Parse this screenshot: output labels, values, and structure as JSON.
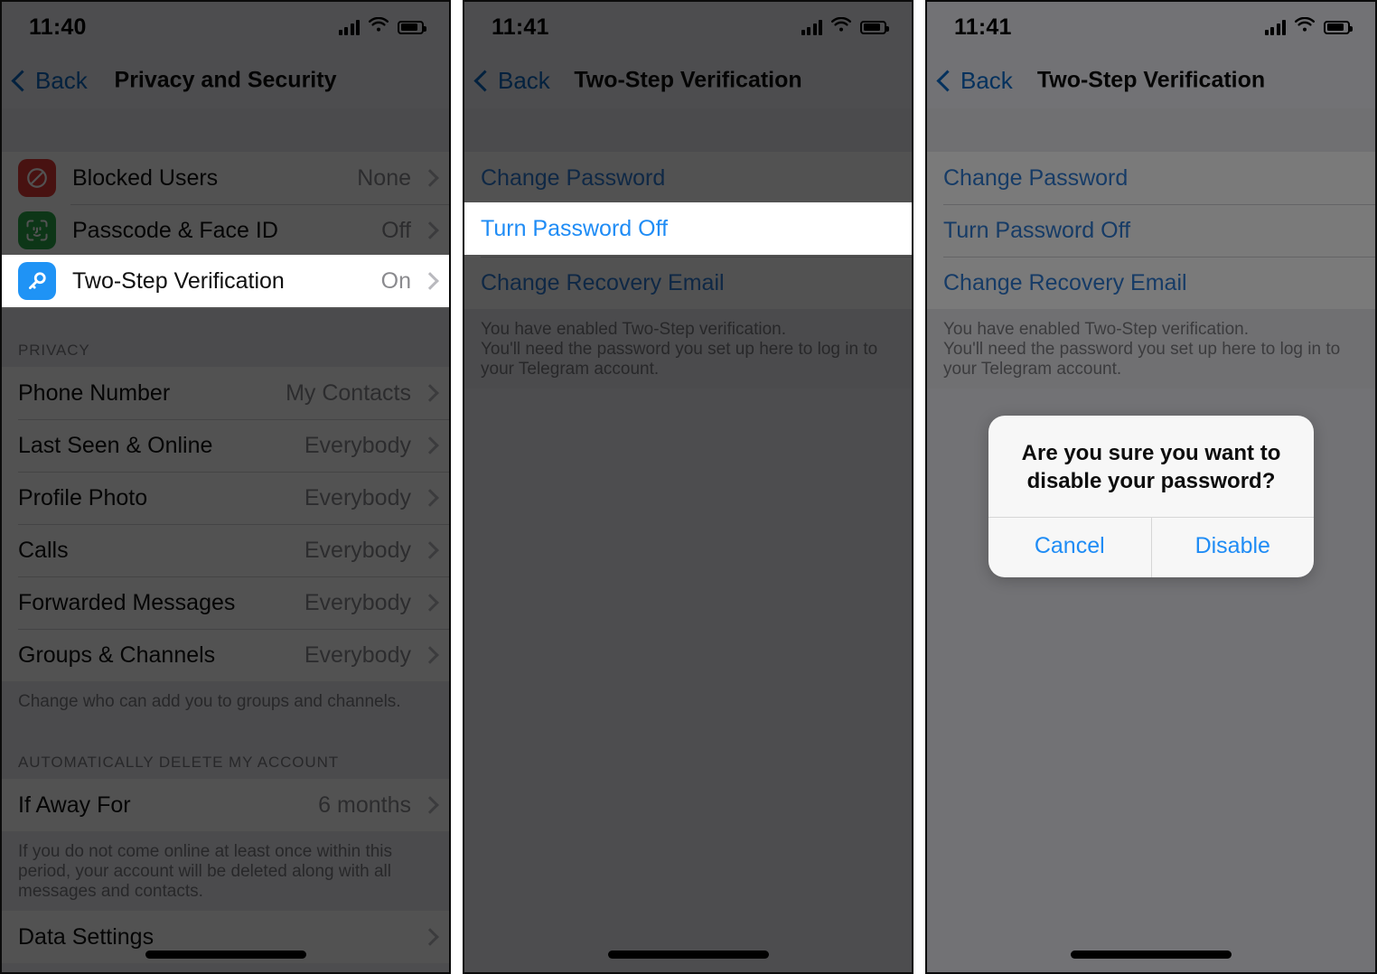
{
  "panels": [
    {
      "status": {
        "time": "11:40",
        "signal_icon": "cellular-bars-icon",
        "wifi_icon": "wifi-icon",
        "battery_icon": "battery-icon"
      },
      "nav": {
        "back_label": "Back",
        "title": "Privacy and Security"
      },
      "security_rows": [
        {
          "icon": "blocked-users-icon",
          "label": "Blocked Users",
          "value": "None"
        },
        {
          "icon": "face-id-icon",
          "label": "Passcode & Face ID",
          "value": "Off"
        },
        {
          "icon": "two-step-key-icon",
          "label": "Two-Step Verification",
          "value": "On"
        }
      ],
      "privacy_section_header": "PRIVACY",
      "privacy_rows": [
        {
          "label": "Phone Number",
          "value": "My Contacts"
        },
        {
          "label": "Last Seen & Online",
          "value": "Everybody"
        },
        {
          "label": "Profile Photo",
          "value": "Everybody"
        },
        {
          "label": "Calls",
          "value": "Everybody"
        },
        {
          "label": "Forwarded Messages",
          "value": "Everybody"
        },
        {
          "label": "Groups & Channels",
          "value": "Everybody"
        }
      ],
      "privacy_footer": "Change who can add you to groups and channels.",
      "delete_section_header": "AUTOMATICALLY DELETE MY ACCOUNT",
      "delete_rows": [
        {
          "label": "If Away For",
          "value": "6 months"
        }
      ],
      "delete_footer": "If you do not come online at least once within this period, your account will be deleted along with all messages and contacts.",
      "last_rows": [
        {
          "label": "Data Settings",
          "value": ""
        }
      ]
    },
    {
      "status": {
        "time": "11:41",
        "signal_icon": "cellular-bars-icon",
        "wifi_icon": "wifi-icon",
        "battery_icon": "battery-icon"
      },
      "nav": {
        "back_label": "Back",
        "title": "Two-Step Verification"
      },
      "links": [
        {
          "label": "Change Password"
        },
        {
          "label": "Turn Password Off"
        },
        {
          "label": "Change Recovery Email"
        }
      ],
      "footer": "You have enabled Two-Step verification.\nYou'll need the password you set up here to log in to your Telegram account."
    },
    {
      "status": {
        "time": "11:41",
        "signal_icon": "cellular-bars-icon",
        "wifi_icon": "wifi-icon",
        "battery_icon": "battery-icon"
      },
      "nav": {
        "back_label": "Back",
        "title": "Two-Step Verification"
      },
      "links": [
        {
          "label": "Change Password"
        },
        {
          "label": "Turn Password Off"
        },
        {
          "label": "Change Recovery Email"
        }
      ],
      "footer": "You have enabled Two-Step verification.\nYou'll need the password you set up here to log in to your Telegram account.",
      "alert": {
        "title": "Are you sure you want to disable your password?",
        "cancel_label": "Cancel",
        "confirm_label": "Disable"
      }
    }
  ],
  "colors": {
    "link_blue": "#2f7cd6",
    "alert_blue": "#1f8cf5",
    "nav_blue": "#0a66c2",
    "blocked_red": "#e03a36",
    "faceid_green": "#2aa84a",
    "key_blue": "#1f93f5"
  }
}
